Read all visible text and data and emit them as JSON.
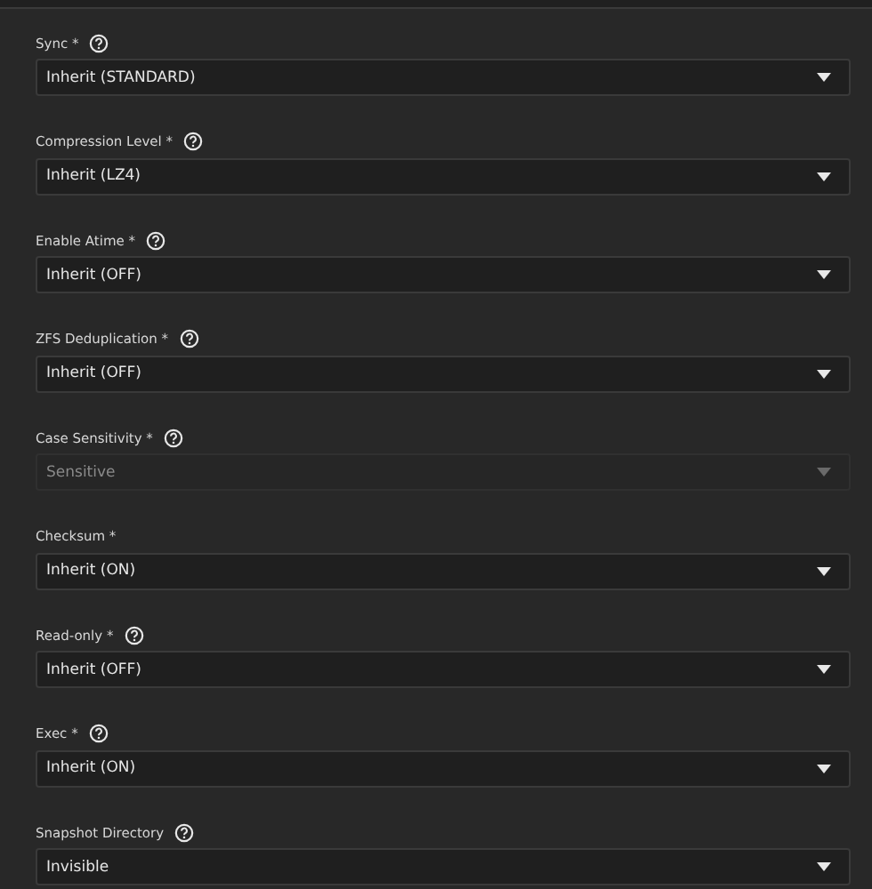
{
  "fields": [
    {
      "label": "Sync *",
      "help": true,
      "value": "Inherit (STANDARD)",
      "disabled": false
    },
    {
      "label": "Compression Level *",
      "help": true,
      "value": "Inherit (LZ4)",
      "disabled": false
    },
    {
      "label": "Enable Atime *",
      "help": true,
      "value": "Inherit (OFF)",
      "disabled": false
    },
    {
      "label": "ZFS Deduplication *",
      "help": true,
      "value": "Inherit (OFF)",
      "disabled": false
    },
    {
      "label": "Case Sensitivity *",
      "help": true,
      "value": "Sensitive",
      "disabled": true
    },
    {
      "label": "Checksum *",
      "help": false,
      "value": "Inherit (ON)",
      "disabled": false
    },
    {
      "label": "Read-only *",
      "help": true,
      "value": "Inherit (OFF)",
      "disabled": false
    },
    {
      "label": "Exec *",
      "help": true,
      "value": "Inherit (ON)",
      "disabled": false
    },
    {
      "label": "Snapshot Directory",
      "help": true,
      "value": "Invisible",
      "disabled": false
    }
  ]
}
